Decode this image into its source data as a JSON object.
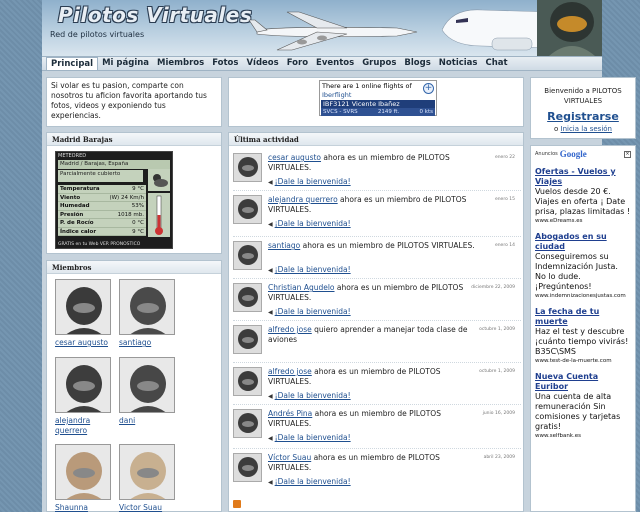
{
  "header": {
    "logo": "Pilotos Virtuales",
    "tagline": "Red de pilotos virtuales"
  },
  "nav": {
    "items": [
      "Principal",
      "Mi página",
      "Miembros",
      "Fotos",
      "Vídeos",
      "Foro",
      "Eventos",
      "Grupos",
      "Blogs",
      "Noticias",
      "Chat"
    ],
    "active": "Principal"
  },
  "intro": {
    "text": "Si volar es tu pasion, comparte con nosotros tu aficion favorita aportando tus fotos, videos y exponiendo tus experiencias."
  },
  "weather": {
    "title": "Madrid Barajas",
    "brand": "METEORED",
    "place": "Madrid / Barajas, España",
    "condition": "Parcialmente cubierto",
    "rows": [
      {
        "label": "Temperatura",
        "value": "9 °C"
      },
      {
        "label": "Viento",
        "value": "(W) 24 Km/h"
      },
      {
        "label": "Humedad",
        "value": "53%"
      },
      {
        "label": "Presión",
        "value": "1018 mb."
      },
      {
        "label": "P. de Rocío",
        "value": "0 °C"
      },
      {
        "label": "Índice calor",
        "value": "9 °C"
      }
    ],
    "footer": "GRATIS en tu Web   VER PRONOSTICO"
  },
  "members": {
    "title": "Miembros",
    "list": [
      {
        "name": "cesar augusto"
      },
      {
        "name": "santiago"
      },
      {
        "name": "alejandra querrero"
      },
      {
        "name": "dani"
      },
      {
        "name": "Shaunna"
      },
      {
        "name": "Victor Suau"
      }
    ]
  },
  "online": {
    "top": "There are 1 online flights of",
    "link": "Iberflight",
    "flight": "IBF3121 Vicente Ibañez",
    "route": "SVCS - SVRS",
    "distance": "2149 ft.",
    "speed": "0 kts"
  },
  "activity": {
    "title": "Última actividad",
    "welcome_link": "¡Dale la bienvenida!",
    "items": [
      {
        "user": "cesar augusto",
        "text": " ahora es un miembro de PILOTOS VIRTUALES.",
        "date": "enero 22",
        "welcome": true
      },
      {
        "user": "alejandra querrero",
        "text": " ahora es un miembro de PILOTOS VIRTUALES.",
        "date": "enero 15",
        "welcome": true
      },
      {
        "user": "santiago",
        "text": " ahora es un miembro de PILOTOS VIRTUALES.",
        "date": "enero 14",
        "welcome": true
      },
      {
        "user": "Christian Agudelo",
        "text": " ahora es un miembro de PILOTOS VIRTUALES.",
        "date": "diciembre 22, 2009",
        "welcome": true
      },
      {
        "user": "alfredo jose",
        "text": " quiero aprender a manejar toda clase de aviones",
        "date": "octubre 1, 2009",
        "welcome": false
      },
      {
        "user": "alfredo jose",
        "text": " ahora es un miembro de PILOTOS VIRTUALES.",
        "date": "octubre 1, 2009",
        "welcome": true
      },
      {
        "user": "Andrés Pina",
        "text": " ahora es un miembro de PILOTOS VIRTUALES.",
        "date": "junio 16, 2009",
        "welcome": true
      },
      {
        "user": "Víctor Suau",
        "text": " ahora es un miembro de PILOTOS VIRTUALES.",
        "date": "abril 23, 2009",
        "welcome": true
      }
    ]
  },
  "register": {
    "welcome": "Bienvenido a PILOTOS VIRTUALES",
    "link": "Registrarse",
    "or": "o",
    "login": "Inicia la sesión"
  },
  "ads": {
    "label": "Anuncios",
    "brand": "Google",
    "items": [
      {
        "title": "Ofertas - Vuelos y Viajes",
        "body": "Vuelos desde 20 €. Viajes en oferta ¡ Date prisa, plazas limitadas !",
        "url": "www.eDreams.es"
      },
      {
        "title": "Abogados en su ciudad",
        "body": "Conseguiremos su Indemnización Justa. No lo dude. ¡Pregúntenos!",
        "url": "www.indemnizacionesjustas.com"
      },
      {
        "title": "La fecha de tu muerte",
        "body": "Haz el test y descubre ¡cuánto tiempo vivirás! B35C\\SMS",
        "url": "www.test-de-la-muerte.com"
      },
      {
        "title": "Nueva Cuenta Euribor",
        "body": "Una cuenta de alta remuneración Sin comisiones y tarjetas gratis!",
        "url": "www.selfbank.es"
      }
    ]
  },
  "colors": {
    "link": "#1f4f8f",
    "page_bg": "#6f8faa",
    "content_bg": "#c7d3dd"
  }
}
